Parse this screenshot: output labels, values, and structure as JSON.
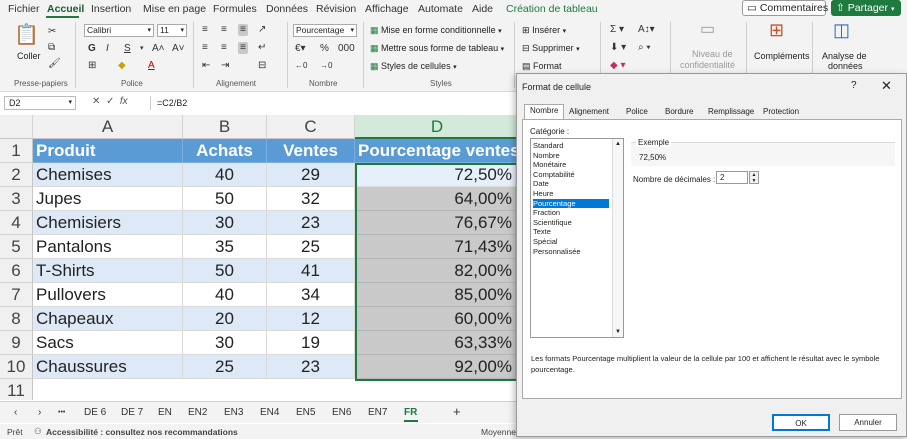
{
  "menu": {
    "tabs": [
      "Fichier",
      "Accueil",
      "Insertion",
      "Mise en page",
      "Formules",
      "Données",
      "Révision",
      "Affichage",
      "Automate",
      "Aide",
      "Création de tableau"
    ],
    "comments": "Commentaires",
    "share": "Partager"
  },
  "ribbon": {
    "paste": "Coller",
    "clipboard_group": "Presse-papiers",
    "font_name": "Calibri",
    "font_size": "11",
    "bold": "G",
    "italic": "I",
    "underline": "S",
    "font_group": "Police",
    "alignment_group": "Alignement",
    "number_format": "Pourcentage",
    "number_group": "Nombre",
    "conditional_formatting": "Mise en forme conditionnelle",
    "format_as_table": "Mettre sous forme de tableau",
    "cell_styles": "Styles de cellules",
    "styles_group": "Styles",
    "insert": "Insérer",
    "delete": "Supprimer",
    "format": "Format",
    "sensitivity_line1": "Niveau de",
    "sensitivity_line2": "confidentialité",
    "addins": "Compléments",
    "analyze_line1": "Analyse de",
    "analyze_line2": "données"
  },
  "formula_bar": {
    "name_box": "D2",
    "fx": "fx",
    "formula": "=C2/B2"
  },
  "grid": {
    "columns": [
      "A",
      "B",
      "C",
      "D"
    ],
    "row_numbers": [
      "1",
      "2",
      "3",
      "4",
      "5",
      "6",
      "7",
      "8",
      "9",
      "10",
      "11"
    ],
    "headers": [
      "Produit",
      "Achats",
      "Ventes",
      "Pourcentage ventes"
    ],
    "rows": [
      [
        "Chemises",
        "40",
        "29",
        "72,50%"
      ],
      [
        "Jupes",
        "50",
        "32",
        "64,00%"
      ],
      [
        "Chemisiers",
        "30",
        "23",
        "76,67%"
      ],
      [
        "Pantalons",
        "35",
        "25",
        "71,43%"
      ],
      [
        "T-Shirts",
        "50",
        "41",
        "82,00%"
      ],
      [
        "Pullovers",
        "40",
        "34",
        "85,00%"
      ],
      [
        "Chapeaux",
        "20",
        "12",
        "60,00%"
      ],
      [
        "Sacs",
        "30",
        "19",
        "63,33%"
      ],
      [
        "Chaussures",
        "25",
        "23",
        "92,00%"
      ]
    ]
  },
  "sheets": {
    "nav_prev": "‹",
    "nav_next": "›",
    "more": "•••",
    "tabs": [
      "DE 6",
      "DE 7",
      "EN",
      "EN2",
      "EN3",
      "EN4",
      "EN5",
      "EN6",
      "EN7",
      "FR"
    ],
    "active": "FR",
    "add": "+"
  },
  "status": {
    "ready": "Prêt",
    "accessibility": "Accessibilité : consultez nos recommandations",
    "average": "Moyenne"
  },
  "dialog": {
    "title": "Format de cellule",
    "help": "?",
    "close": "✕",
    "tabs": [
      "Nombre",
      "Alignement",
      "Police",
      "Bordure",
      "Remplissage",
      "Protection"
    ],
    "category_label": "Catégorie :",
    "categories": [
      "Standard",
      "Nombre",
      "Monétaire",
      "Comptabilité",
      "Date",
      "Heure",
      "Pourcentage",
      "Fraction",
      "Scientifique",
      "Texte",
      "Spécial",
      "Personnalisée"
    ],
    "selected_category": "Pourcentage",
    "sample_label": "Exemple",
    "sample_value": "72,50%",
    "decimals_label": "Nombre de décimales :",
    "decimals_value": "2",
    "description": "Les formats Pourcentage multiplient la valeur de la cellule par 100 et affichent le résultat avec le symbole pourcentage.",
    "ok": "OK",
    "cancel": "Annuler"
  }
}
